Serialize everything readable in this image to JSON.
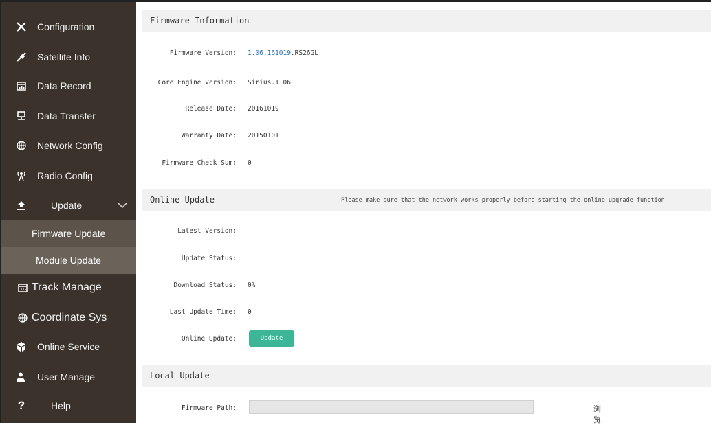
{
  "sidebar": {
    "items": [
      {
        "label": "Configuration",
        "icon": "tools-icon"
      },
      {
        "label": "Satellite Info",
        "icon": "satellite-icon"
      },
      {
        "label": "Data Record",
        "icon": "calendar-chart-icon"
      },
      {
        "label": "Data Transfer",
        "icon": "network-monitor-icon"
      },
      {
        "label": "Network Config",
        "icon": "globe-icon"
      },
      {
        "label": "Radio Config",
        "icon": "radio-tower-icon"
      },
      {
        "label": "Update",
        "icon": "upload-icon"
      },
      {
        "label": "Track Manage",
        "icon": "calendar-chart-icon"
      },
      {
        "label": "Coordinate Sys",
        "icon": "globe-icon"
      },
      {
        "label": "Online Service",
        "icon": "cube-icon"
      },
      {
        "label": "User Manage",
        "icon": "user-icon"
      },
      {
        "label": "Help",
        "icon": "question-icon"
      }
    ],
    "submenu": [
      {
        "label": "Firmware Update",
        "active": true
      },
      {
        "label": "Module Update",
        "active": false
      }
    ]
  },
  "firmware_info": {
    "title": "Firmware Information",
    "rows": [
      {
        "label": "Firmware Version:",
        "value_link": "1.06.161019",
        "value_suffix": ".RS26GL"
      },
      {
        "label": "Core Engine Version:",
        "value": "Sirius.1.06"
      },
      {
        "label": "Release Date:",
        "value": "20161019"
      },
      {
        "label": "Warranty Date:",
        "value": "20150101"
      },
      {
        "label": "Firmware Check Sum:",
        "value": "0"
      }
    ]
  },
  "online_update": {
    "title": "Online Update",
    "note": "Please make sure that the network works properly before starting the online upgrade function",
    "rows": [
      {
        "label": "Latest Version:",
        "value": ""
      },
      {
        "label": "Update Status:",
        "value": ""
      },
      {
        "label": "Download Status:",
        "value": "0%"
      },
      {
        "label": "Last Update Time:",
        "value": "0"
      },
      {
        "label": "Online Update:",
        "value": ""
      }
    ],
    "button_label": "Update"
  },
  "local_update": {
    "title": "Local Update",
    "path_label": "Firmware Path:",
    "path_value": "",
    "browse_label": "浏览..."
  },
  "colors": {
    "sidebar_bg": "#3b332b",
    "submenu_bg": "#6b625a",
    "accent": "#3cb696"
  }
}
